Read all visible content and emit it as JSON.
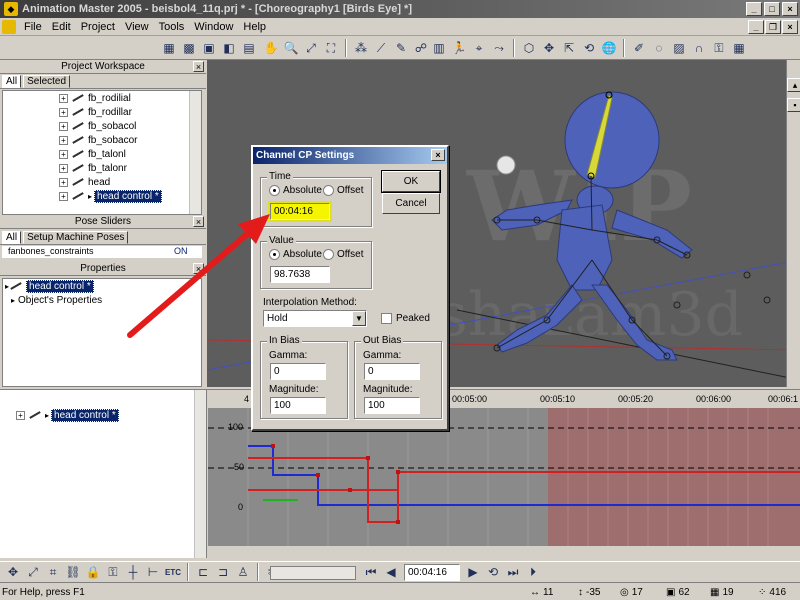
{
  "window": {
    "title": "Animation Master 2005 - beisbol4_11q.prj * - [Choreography1 [Birds Eye] *]"
  },
  "menu": {
    "items": [
      "File",
      "Edit",
      "Project",
      "View",
      "Tools",
      "Window",
      "Help"
    ]
  },
  "project_workspace": {
    "title": "Project Workspace",
    "tabs": [
      "All",
      "Selected"
    ],
    "items": [
      "fb_rodilial",
      "fb_rodillar",
      "fb_sobacol",
      "fb_sobacor",
      "fb_talonl",
      "fb_talonr",
      "head",
      "head control *"
    ]
  },
  "pose_sliders": {
    "title": "Pose Sliders",
    "tabs": [
      "All",
      "Setup Machine Poses"
    ],
    "row_label": "fanbones_constraints",
    "row_value": "ON"
  },
  "properties": {
    "title": "Properties",
    "items": [
      "head control *",
      "Object's Properties"
    ]
  },
  "viewport": {
    "watermark_1": "WIP",
    "watermark_2": "shazam3d"
  },
  "timeline": {
    "tree_item": "head control *",
    "frame_label": "4",
    "time_labels": [
      "00:05:00",
      "00:05:10",
      "00:05:20",
      "00:06:00",
      "00:06:1"
    ],
    "y_labels": [
      "100",
      "50",
      "0"
    ]
  },
  "dialog": {
    "title": "Channel CP Settings",
    "close": "×",
    "time_group": "Time",
    "time_absolute": "Absolute",
    "time_offset": "Offset",
    "time_value": "00:04:16",
    "value_group": "Value",
    "value_absolute": "Absolute",
    "value_offset": "Offset",
    "value_value": "98.7638",
    "ok": "OK",
    "cancel": "Cancel",
    "interp_label": "Interpolation Method:",
    "interp_value": "Hold",
    "peaked": "Peaked",
    "in_bias": "In Bias",
    "out_bias": "Out Bias",
    "gamma": "Gamma:",
    "magnitude": "Magnitude:",
    "in_gamma": "0",
    "in_magnitude": "100",
    "out_gamma": "0",
    "out_magnitude": "100"
  },
  "bottombar": {
    "etc": "ETC",
    "time": "00:04:16"
  },
  "status": {
    "help": "For Help, press F1",
    "f1": "11",
    "f2": "-35",
    "f3": "17",
    "f4": "62",
    "f5": "19",
    "f6": "416"
  },
  "colors": {
    "highlight_yellow": "#f5f500",
    "arrow_red": "#e41b1b",
    "character_blue": "#4d62b8",
    "bone_yellow": "#e6e62e",
    "selection_navy": "#0a246a"
  }
}
